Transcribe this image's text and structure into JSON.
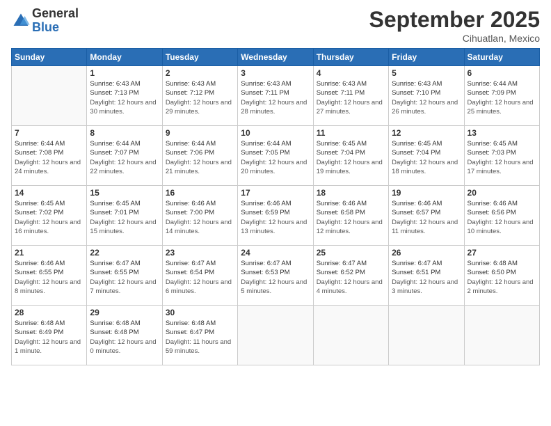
{
  "logo": {
    "general": "General",
    "blue": "Blue"
  },
  "header": {
    "month": "September 2025",
    "location": "Cihuatlan, Mexico"
  },
  "weekdays": [
    "Sunday",
    "Monday",
    "Tuesday",
    "Wednesday",
    "Thursday",
    "Friday",
    "Saturday"
  ],
  "weeks": [
    [
      {
        "day": "",
        "sunrise": "",
        "sunset": "",
        "daylight": ""
      },
      {
        "day": "1",
        "sunrise": "Sunrise: 6:43 AM",
        "sunset": "Sunset: 7:13 PM",
        "daylight": "Daylight: 12 hours and 30 minutes."
      },
      {
        "day": "2",
        "sunrise": "Sunrise: 6:43 AM",
        "sunset": "Sunset: 7:12 PM",
        "daylight": "Daylight: 12 hours and 29 minutes."
      },
      {
        "day": "3",
        "sunrise": "Sunrise: 6:43 AM",
        "sunset": "Sunset: 7:11 PM",
        "daylight": "Daylight: 12 hours and 28 minutes."
      },
      {
        "day": "4",
        "sunrise": "Sunrise: 6:43 AM",
        "sunset": "Sunset: 7:11 PM",
        "daylight": "Daylight: 12 hours and 27 minutes."
      },
      {
        "day": "5",
        "sunrise": "Sunrise: 6:43 AM",
        "sunset": "Sunset: 7:10 PM",
        "daylight": "Daylight: 12 hours and 26 minutes."
      },
      {
        "day": "6",
        "sunrise": "Sunrise: 6:44 AM",
        "sunset": "Sunset: 7:09 PM",
        "daylight": "Daylight: 12 hours and 25 minutes."
      }
    ],
    [
      {
        "day": "7",
        "sunrise": "Sunrise: 6:44 AM",
        "sunset": "Sunset: 7:08 PM",
        "daylight": "Daylight: 12 hours and 24 minutes."
      },
      {
        "day": "8",
        "sunrise": "Sunrise: 6:44 AM",
        "sunset": "Sunset: 7:07 PM",
        "daylight": "Daylight: 12 hours and 22 minutes."
      },
      {
        "day": "9",
        "sunrise": "Sunrise: 6:44 AM",
        "sunset": "Sunset: 7:06 PM",
        "daylight": "Daylight: 12 hours and 21 minutes."
      },
      {
        "day": "10",
        "sunrise": "Sunrise: 6:44 AM",
        "sunset": "Sunset: 7:05 PM",
        "daylight": "Daylight: 12 hours and 20 minutes."
      },
      {
        "day": "11",
        "sunrise": "Sunrise: 6:45 AM",
        "sunset": "Sunset: 7:04 PM",
        "daylight": "Daylight: 12 hours and 19 minutes."
      },
      {
        "day": "12",
        "sunrise": "Sunrise: 6:45 AM",
        "sunset": "Sunset: 7:04 PM",
        "daylight": "Daylight: 12 hours and 18 minutes."
      },
      {
        "day": "13",
        "sunrise": "Sunrise: 6:45 AM",
        "sunset": "Sunset: 7:03 PM",
        "daylight": "Daylight: 12 hours and 17 minutes."
      }
    ],
    [
      {
        "day": "14",
        "sunrise": "Sunrise: 6:45 AM",
        "sunset": "Sunset: 7:02 PM",
        "daylight": "Daylight: 12 hours and 16 minutes."
      },
      {
        "day": "15",
        "sunrise": "Sunrise: 6:45 AM",
        "sunset": "Sunset: 7:01 PM",
        "daylight": "Daylight: 12 hours and 15 minutes."
      },
      {
        "day": "16",
        "sunrise": "Sunrise: 6:46 AM",
        "sunset": "Sunset: 7:00 PM",
        "daylight": "Daylight: 12 hours and 14 minutes."
      },
      {
        "day": "17",
        "sunrise": "Sunrise: 6:46 AM",
        "sunset": "Sunset: 6:59 PM",
        "daylight": "Daylight: 12 hours and 13 minutes."
      },
      {
        "day": "18",
        "sunrise": "Sunrise: 6:46 AM",
        "sunset": "Sunset: 6:58 PM",
        "daylight": "Daylight: 12 hours and 12 minutes."
      },
      {
        "day": "19",
        "sunrise": "Sunrise: 6:46 AM",
        "sunset": "Sunset: 6:57 PM",
        "daylight": "Daylight: 12 hours and 11 minutes."
      },
      {
        "day": "20",
        "sunrise": "Sunrise: 6:46 AM",
        "sunset": "Sunset: 6:56 PM",
        "daylight": "Daylight: 12 hours and 10 minutes."
      }
    ],
    [
      {
        "day": "21",
        "sunrise": "Sunrise: 6:46 AM",
        "sunset": "Sunset: 6:55 PM",
        "daylight": "Daylight: 12 hours and 8 minutes."
      },
      {
        "day": "22",
        "sunrise": "Sunrise: 6:47 AM",
        "sunset": "Sunset: 6:55 PM",
        "daylight": "Daylight: 12 hours and 7 minutes."
      },
      {
        "day": "23",
        "sunrise": "Sunrise: 6:47 AM",
        "sunset": "Sunset: 6:54 PM",
        "daylight": "Daylight: 12 hours and 6 minutes."
      },
      {
        "day": "24",
        "sunrise": "Sunrise: 6:47 AM",
        "sunset": "Sunset: 6:53 PM",
        "daylight": "Daylight: 12 hours and 5 minutes."
      },
      {
        "day": "25",
        "sunrise": "Sunrise: 6:47 AM",
        "sunset": "Sunset: 6:52 PM",
        "daylight": "Daylight: 12 hours and 4 minutes."
      },
      {
        "day": "26",
        "sunrise": "Sunrise: 6:47 AM",
        "sunset": "Sunset: 6:51 PM",
        "daylight": "Daylight: 12 hours and 3 minutes."
      },
      {
        "day": "27",
        "sunrise": "Sunrise: 6:48 AM",
        "sunset": "Sunset: 6:50 PM",
        "daylight": "Daylight: 12 hours and 2 minutes."
      }
    ],
    [
      {
        "day": "28",
        "sunrise": "Sunrise: 6:48 AM",
        "sunset": "Sunset: 6:49 PM",
        "daylight": "Daylight: 12 hours and 1 minute."
      },
      {
        "day": "29",
        "sunrise": "Sunrise: 6:48 AM",
        "sunset": "Sunset: 6:48 PM",
        "daylight": "Daylight: 12 hours and 0 minutes."
      },
      {
        "day": "30",
        "sunrise": "Sunrise: 6:48 AM",
        "sunset": "Sunset: 6:47 PM",
        "daylight": "Daylight: 11 hours and 59 minutes."
      },
      {
        "day": "",
        "sunrise": "",
        "sunset": "",
        "daylight": ""
      },
      {
        "day": "",
        "sunrise": "",
        "sunset": "",
        "daylight": ""
      },
      {
        "day": "",
        "sunrise": "",
        "sunset": "",
        "daylight": ""
      },
      {
        "day": "",
        "sunrise": "",
        "sunset": "",
        "daylight": ""
      }
    ]
  ]
}
